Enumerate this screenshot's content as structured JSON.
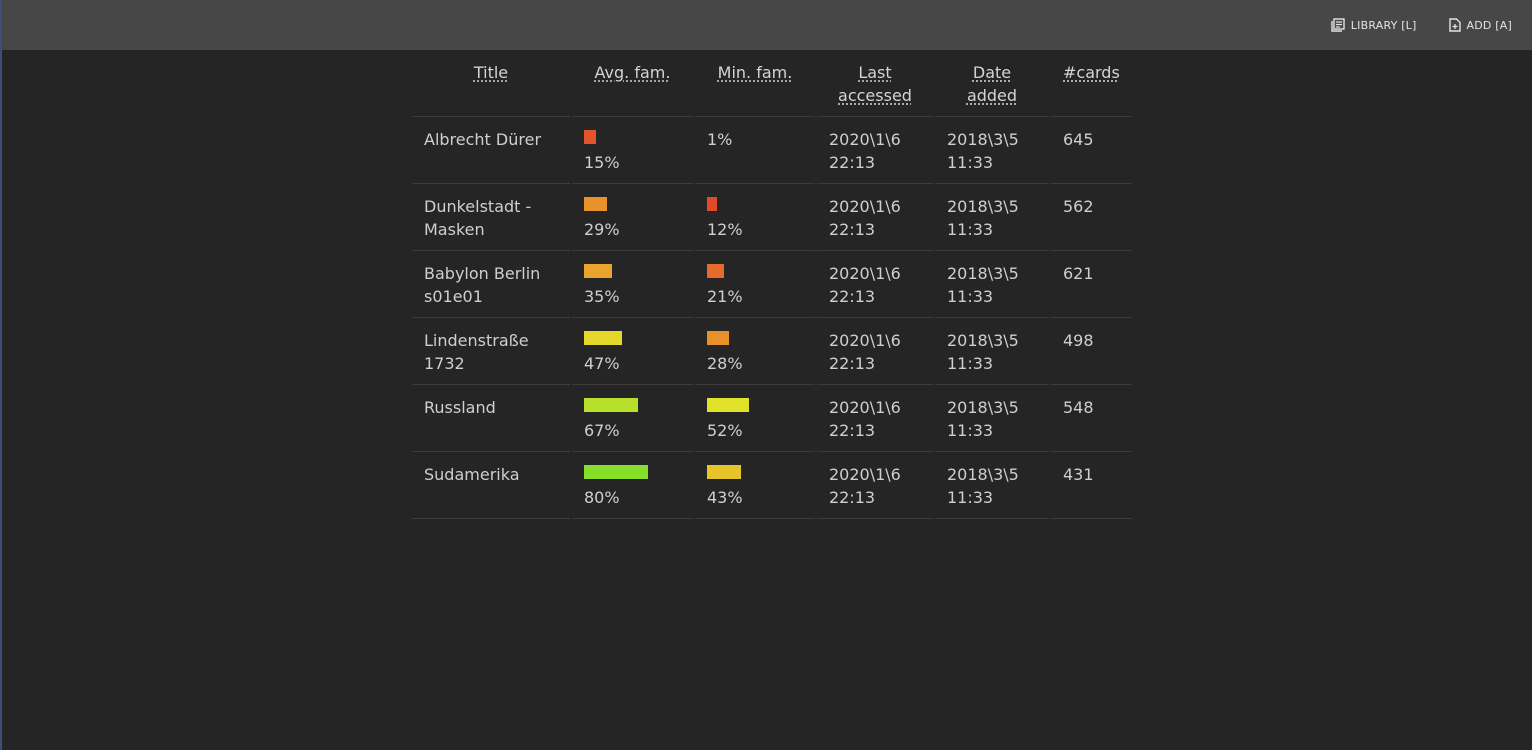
{
  "toolbar": {
    "library_label": "LIBRARY [L]",
    "add_label": "ADD [A]",
    "library_icon": "library-icon",
    "add_icon": "add-file-icon"
  },
  "table": {
    "headers": {
      "title": "Title",
      "avg": "Avg. fam.",
      "min": "Min. fam.",
      "last": "Last accessed",
      "added": "Date added",
      "cards": "#cards"
    },
    "rows": [
      {
        "title": "Albrecht Dürer",
        "avg": "15%",
        "avg_value": 15,
        "avg_color": "#e2552c",
        "min": "1%",
        "min_value": 1,
        "min_color": "#e2442a",
        "last": "2020\\1\\6 22:13",
        "added": "2018\\3\\5 11:33",
        "cards": "645"
      },
      {
        "title": "Dunkelstadt - Masken",
        "avg": "29%",
        "avg_value": 29,
        "avg_color": "#e8922c",
        "min": "12%",
        "min_value": 12,
        "min_color": "#e24a2a",
        "last": "2020\\1\\6 22:13",
        "added": "2018\\3\\5 11:33",
        "cards": "562"
      },
      {
        "title": "Babylon Berlin s01e01",
        "avg": "35%",
        "avg_value": 35,
        "avg_color": "#e8a42c",
        "min": "21%",
        "min_value": 21,
        "min_color": "#e56a2c",
        "last": "2020\\1\\6 22:13",
        "added": "2018\\3\\5 11:33",
        "cards": "621"
      },
      {
        "title": "Lindenstraße 1732",
        "avg": "47%",
        "avg_value": 47,
        "avg_color": "#e6d82a",
        "min": "28%",
        "min_value": 28,
        "min_color": "#e8902c",
        "last": "2020\\1\\6 22:13",
        "added": "2018\\3\\5 11:33",
        "cards": "498"
      },
      {
        "title": "Russland",
        "avg": "67%",
        "avg_value": 67,
        "avg_color": "#b6e02a",
        "min": "52%",
        "min_value": 52,
        "min_color": "#e3e22a",
        "last": "2020\\1\\6 22:13",
        "added": "2018\\3\\5 11:33",
        "cards": "548"
      },
      {
        "title": "Sudamerika",
        "avg": "80%",
        "avg_value": 80,
        "avg_color": "#86e02a",
        "min": "43%",
        "min_value": 43,
        "min_color": "#e6c42a",
        "last": "2020\\1\\6 22:13",
        "added": "2018\\3\\5 11:33",
        "cards": "431"
      }
    ]
  }
}
